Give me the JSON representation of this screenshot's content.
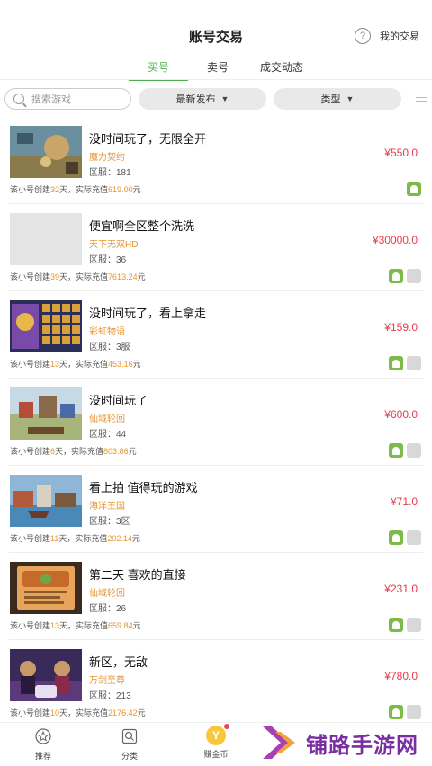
{
  "header": {
    "title": "账号交易",
    "my_trade": "我的交易",
    "help_icon": "?",
    "tabs": [
      {
        "label": "买号",
        "active": true
      },
      {
        "label": "卖号",
        "active": false
      },
      {
        "label": "成交动态",
        "active": false
      }
    ]
  },
  "filters": {
    "search_placeholder": "搜索游戏",
    "sort_label": "最新发布",
    "type_label": "类型",
    "dropdown_arrow": "▼"
  },
  "colors": {
    "accent": "#4cae4c",
    "price": "#e63c4c",
    "game_name": "#e8942f",
    "android": "#7cbb4a"
  },
  "listings": [
    {
      "title": "没时间玩了，无限全开",
      "game": "魔力契约",
      "server": "区服：181",
      "price": "¥550.0",
      "days": "32",
      "recharge": "619.00",
      "badges": [
        "android"
      ],
      "thumb": "tower"
    },
    {
      "title": "便宜啊全区整个洗洗",
      "game": "天下无双HD",
      "server": "区服：36",
      "price": "¥30000.0",
      "days": "39",
      "recharge": "7613.24",
      "badges": [
        "android",
        "gray"
      ],
      "thumb": "blank"
    },
    {
      "title": "没时间玩了，看上拿走",
      "game": "彩虹物语",
      "server": "区服：3服",
      "price": "¥159.0",
      "days": "13",
      "recharge": "453.16",
      "badges": [
        "android",
        "gray"
      ],
      "thumb": "grid"
    },
    {
      "title": "没时间玩了",
      "game": "仙域轮回",
      "server": "区服：44",
      "price": "¥600.0",
      "days": "6",
      "recharge": "803.86",
      "badges": [
        "android",
        "gray"
      ],
      "thumb": "town"
    },
    {
      "title": "看上拍 值得玩的游戏",
      "game": "海洋王国",
      "server": "区服：3区",
      "price": "¥71.0",
      "days": "11",
      "recharge": "202.14",
      "badges": [
        "android",
        "gray"
      ],
      "thumb": "harbor"
    },
    {
      "title": "第二天  喜欢的直接",
      "game": "仙域轮回",
      "server": "区服：26",
      "price": "¥231.0",
      "days": "13",
      "recharge": "659.84",
      "badges": [
        "android",
        "gray"
      ],
      "thumb": "dialog"
    },
    {
      "title": "新区，无敌",
      "game": "万剑至尊",
      "server": "区服：213",
      "price": "¥780.0",
      "days": "10",
      "recharge": "2176.42",
      "badges": [
        "android",
        "gray"
      ],
      "thumb": "heroes"
    }
  ],
  "meta_text": {
    "prefix": "该小号创建",
    "days_unit": "天，实际充值",
    "currency_unit": "元"
  },
  "bottom_nav": [
    {
      "label": "推荐",
      "icon": "star-icon"
    },
    {
      "label": "分类",
      "icon": "category-icon"
    },
    {
      "label": "赚金币",
      "icon": "coin-icon",
      "glyph": "Y"
    }
  ],
  "watermark": "铺路手游网"
}
